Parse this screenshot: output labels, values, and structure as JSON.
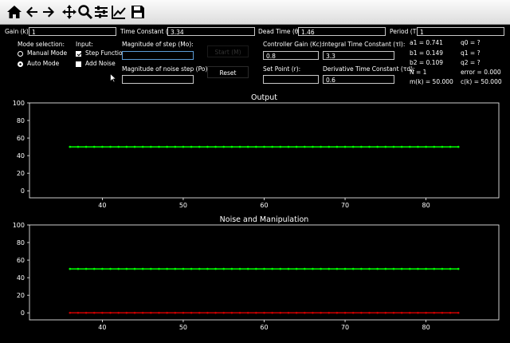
{
  "toolbar": {
    "buttons": [
      {
        "name": "home-icon"
      },
      {
        "name": "back-arrow-icon"
      },
      {
        "name": "forward-arrow-icon"
      },
      {
        "name": "pan-icon"
      },
      {
        "name": "zoom-icon"
      },
      {
        "name": "configure-subplots-icon"
      },
      {
        "name": "edit-axis-icon"
      },
      {
        "name": "save-icon"
      }
    ]
  },
  "params_row": {
    "gain_label": "Gain (k):",
    "gain_value": "1",
    "time_constant_label": "Time Constant (τ):",
    "time_constant_value": "3.34",
    "dead_time_label": "Dead Time (θ'):",
    "dead_time_value": "1.46",
    "period_label": "Period (T):",
    "period_value": "1"
  },
  "mode": {
    "title": "Mode selection:",
    "manual_label": "Manual Mode",
    "manual_selected": false,
    "auto_label": "Auto Mode",
    "auto_selected": true
  },
  "input": {
    "title": "Input:",
    "step_label": "Step Function",
    "step_checked": true,
    "noise_label": "Add Noise",
    "noise_checked": false
  },
  "step": {
    "mo_label": "Magnitude of step (Mo):",
    "mo_value": "",
    "po_label": "Magnitude of noise step (Po):",
    "po_value": "",
    "start_button": "Start (M)",
    "reset_button": "Reset"
  },
  "controller": {
    "kc_label": "Controller Gain (Kc):",
    "kc_value": "0.8",
    "ti_label": "Integral Time Constant (τI):",
    "ti_value": "3.3",
    "sp_label": "Set Point (r):",
    "sp_value": "",
    "td_label": "Derivative Time Constant (τd):",
    "td_value": "0.6"
  },
  "coefficients": {
    "a1": "a1 = 0.741",
    "b1": "b1 = 0.149",
    "b2": "b2 = 0.109",
    "n": "N = 1",
    "mk": "m(k) = 50.000",
    "q0": "q0 = ?",
    "q1": "q1 = ?",
    "q2": "q2 = ?",
    "error": "error = 0.000",
    "ck": "c(k) = 50.000"
  },
  "colors": {
    "green": "#00ff00",
    "red": "#cc0000",
    "axis": "#ffffff"
  },
  "chart_data": [
    {
      "type": "line",
      "title": "Output",
      "xlim": [
        31,
        89
      ],
      "ylim": [
        -8,
        100
      ],
      "xticks": [
        40,
        50,
        60,
        70,
        80
      ],
      "yticks": [
        0,
        20,
        40,
        60,
        80,
        100
      ],
      "series": [
        {
          "color": "#00ff00",
          "x_start": 36,
          "x_end": 84,
          "value": 50
        }
      ]
    },
    {
      "type": "line",
      "title": "Noise and Manipulation",
      "xlim": [
        31,
        89
      ],
      "ylim": [
        -8,
        100
      ],
      "xticks": [
        40,
        50,
        60,
        70,
        80
      ],
      "yticks": [
        0,
        20,
        40,
        60,
        80,
        100
      ],
      "series": [
        {
          "color": "#00ff00",
          "x_start": 36,
          "x_end": 84,
          "value": 50
        },
        {
          "color": "#cc0000",
          "x_start": 36,
          "x_end": 84,
          "value": 0
        }
      ]
    }
  ]
}
